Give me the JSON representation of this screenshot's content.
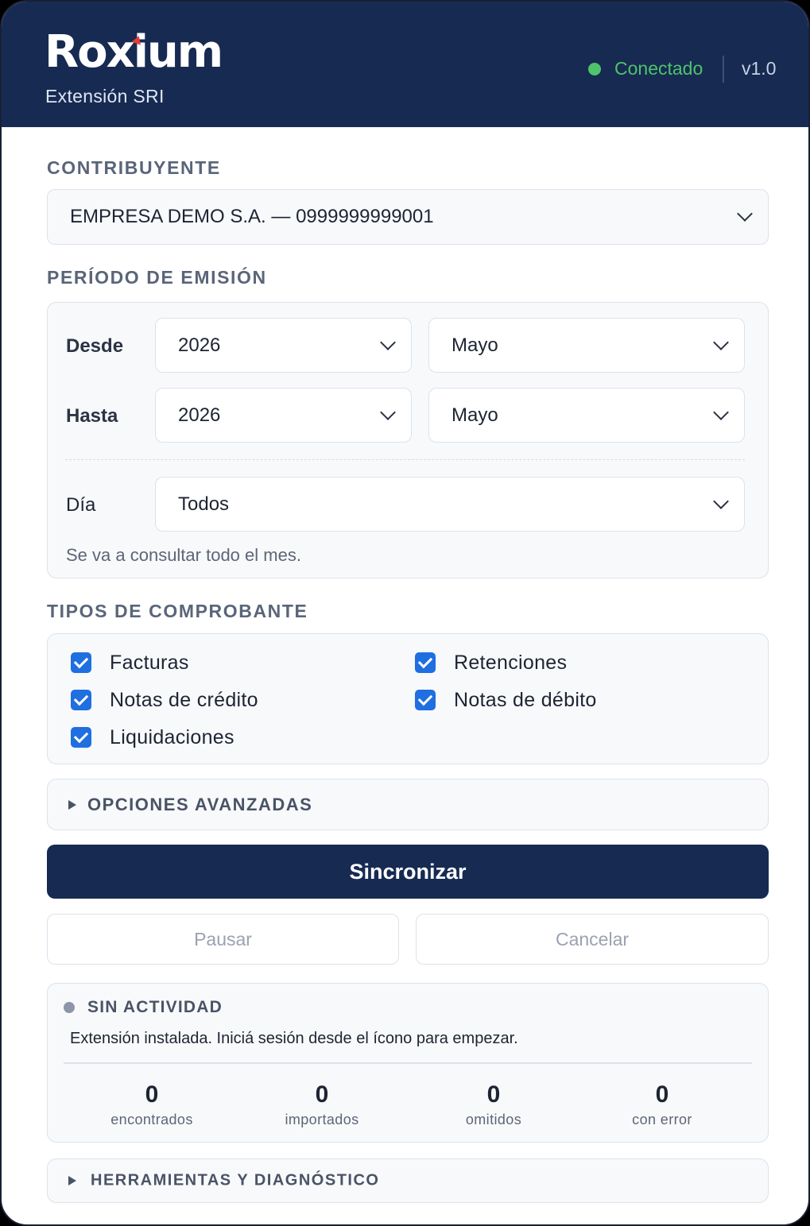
{
  "header": {
    "logo": "Roxium",
    "subtitle": "Extensión SRI",
    "status": "Conectado",
    "version": "v1.0",
    "status_color": "#4ec36b",
    "brand_color": "#172a52",
    "logo_accent_color": "#e23b3b"
  },
  "contribuyente": {
    "label": "CONTRIBUYENTE",
    "value": "EMPRESA DEMO S.A. — 0999999999001"
  },
  "periodo": {
    "label": "PERÍODO DE EMISIÓN",
    "desde": {
      "label": "Desde",
      "year": "2026",
      "month": "Mayo"
    },
    "hasta": {
      "label": "Hasta",
      "year": "2026",
      "month": "Mayo"
    },
    "dia": {
      "label": "Día",
      "value": "Todos"
    },
    "hint": "Se va a consultar todo el mes."
  },
  "tipos": {
    "label": "TIPOS DE COMPROBANTE",
    "items": [
      {
        "label": "Facturas",
        "checked": true
      },
      {
        "label": "Retenciones",
        "checked": true
      },
      {
        "label": "Notas de crédito",
        "checked": true
      },
      {
        "label": "Notas de débito",
        "checked": true
      },
      {
        "label": "Liquidaciones",
        "checked": true
      }
    ]
  },
  "avanzadas": {
    "label": "OPCIONES AVANZADAS"
  },
  "actions": {
    "sync": "Sincronizar",
    "pause": "Pausar",
    "cancel": "Cancelar"
  },
  "activity": {
    "title": "SIN ACTIVIDAD",
    "message": "Extensión instalada. Iniciá sesión desde el ícono para empezar.",
    "stats": [
      {
        "value": "0",
        "label": "encontrados"
      },
      {
        "value": "0",
        "label": "importados"
      },
      {
        "value": "0",
        "label": "omitidos"
      },
      {
        "value": "0",
        "label": "con error"
      }
    ]
  },
  "herramientas": {
    "label": "HERRAMIENTAS Y DIAGNÓSTICO"
  }
}
